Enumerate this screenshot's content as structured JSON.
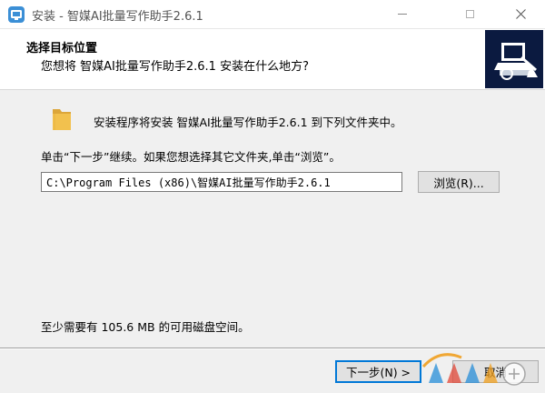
{
  "window": {
    "title": "安装 - 智媒AI批量写作助手2.6.1"
  },
  "header": {
    "title": "选择目标位置",
    "subtitle": "您想将 智媒AI批量写作助手2.6.1 安装在什么地方?"
  },
  "content": {
    "install_message": "安装程序将安装 智媒AI批量写作助手2.6.1 到下列文件夹中。",
    "instruction": "单击“下一步”继续。如果您想选择其它文件夹,单击“浏览”。",
    "path_value": "C:\\Program Files (x86)\\智媒AI批量写作助手2.6.1",
    "browse_label": "浏览(R)...",
    "disk_space": "至少需要有 105.6 MB 的可用磁盘空间。"
  },
  "footer": {
    "next_label": "下一步(N) >",
    "cancel_label": "取消"
  },
  "colors": {
    "accent": "#0078d7",
    "logo_bg": "#0b1a40",
    "folder": "#f2c14e"
  }
}
